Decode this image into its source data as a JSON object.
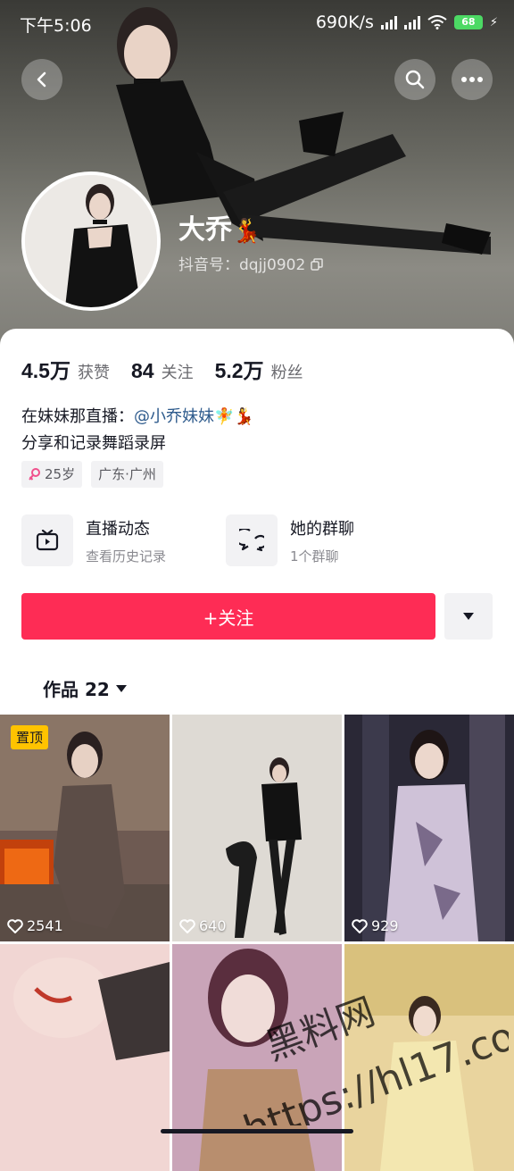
{
  "status_bar": {
    "time": "下午5:06",
    "network_speed": "690K/s",
    "battery": "68"
  },
  "profile": {
    "nickname": "大乔",
    "nickname_emoji": "💃",
    "douyin_id": "抖音号：dqjj0902"
  },
  "stats": [
    {
      "value": "4.5万",
      "label": "获赞"
    },
    {
      "value": "84",
      "label": "关注"
    },
    {
      "value": "5.2万",
      "label": "粉丝"
    }
  ],
  "bio": {
    "line1_prefix": "在妹妹那直播：",
    "mention": "@小乔妹妹",
    "line1_emoji": "🧚💃",
    "line2": "分享和记录舞蹈录屏"
  },
  "tags": {
    "age": "25岁",
    "location": "广东·广州"
  },
  "features": [
    {
      "title": "直播动态",
      "subtitle": "查看历史记录",
      "icon": "tv-icon"
    },
    {
      "title": "她的群聊",
      "subtitle": "1个群聊",
      "icon": "chat-icon"
    }
  ],
  "follow_button": "+关注",
  "works_tab": {
    "label": "作品 22"
  },
  "videos": [
    {
      "likes": "2541",
      "pinned_label": "置顶"
    },
    {
      "likes": "640"
    },
    {
      "likes": "929"
    },
    {},
    {},
    {}
  ],
  "watermark": {
    "line1": "黑料网",
    "line2": "https://hl17.co"
  },
  "colors": {
    "accent": "#fe2c55",
    "mention": "#2d5a8c",
    "pin_badge": "#ffc300"
  }
}
